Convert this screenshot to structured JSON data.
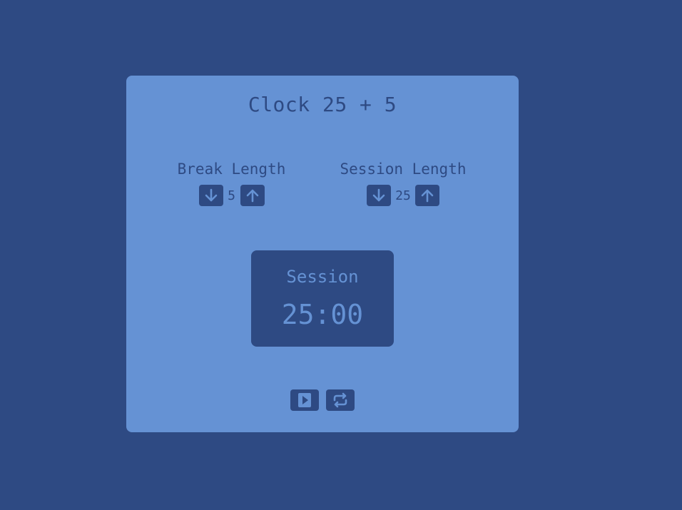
{
  "app": {
    "title": "Clock 25 + 5"
  },
  "break": {
    "label": "Break Length",
    "value": "5",
    "decrement_icon": "arrow-down-icon",
    "increment_icon": "arrow-up-icon"
  },
  "session": {
    "label": "Session Length",
    "value": "25",
    "decrement_icon": "arrow-down-icon",
    "increment_icon": "arrow-up-icon"
  },
  "timer": {
    "label": "Session",
    "display": "25:00"
  },
  "actions": {
    "start_icon": "play-icon",
    "reset_icon": "repeat-icon"
  },
  "colors": {
    "background": "#2e4a83",
    "card": "#6592d4",
    "accent": "#2e4a83"
  }
}
